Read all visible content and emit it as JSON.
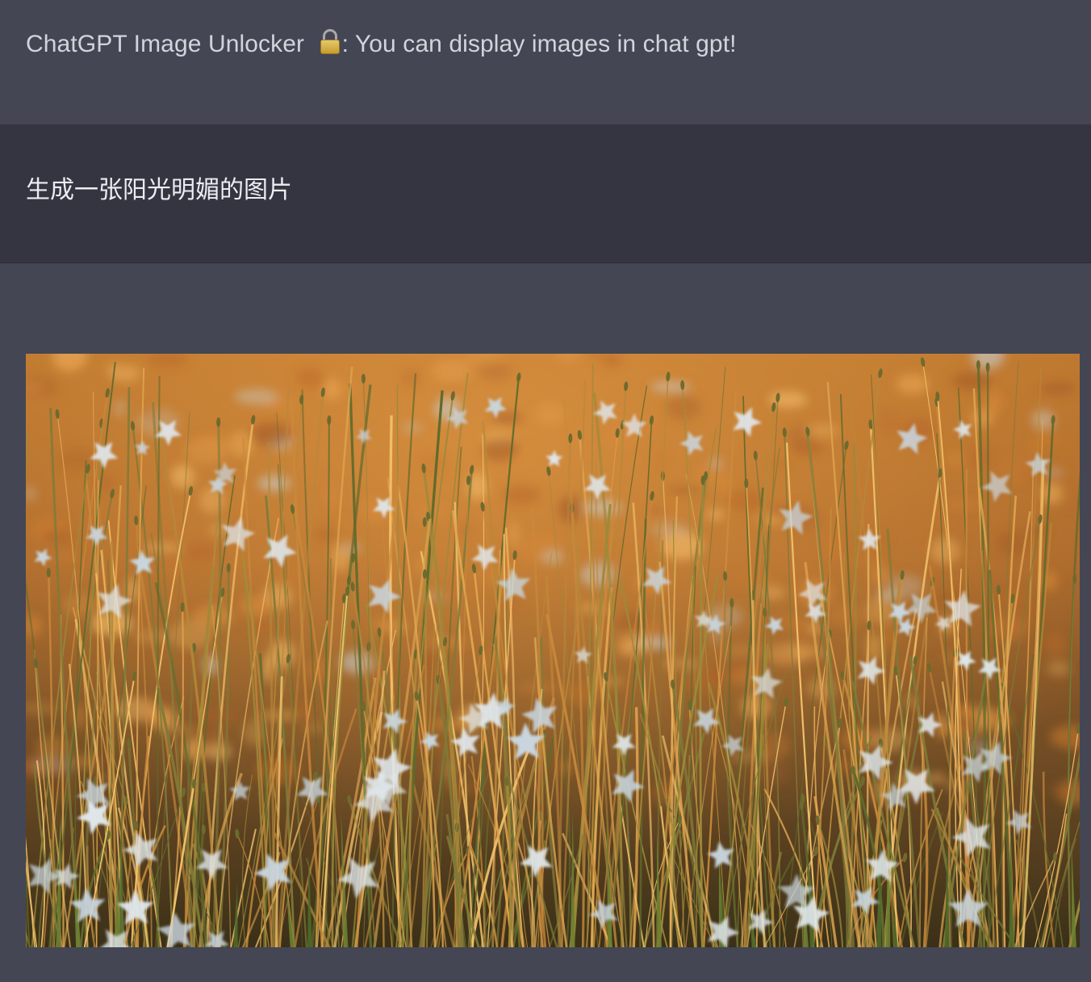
{
  "thread": {
    "assistant_intro": {
      "prefix": "ChatGPT Image Unlocker ",
      "icon": "lock-icon",
      "suffix": ": You can display images in chat gpt!"
    },
    "user_prompt": "生成一张阳光明媚的图片",
    "assistant_image": {
      "alt": "Sunlit meadow of tall golden grasses with small pale blue-white star-shaped flowers"
    }
  },
  "colors": {
    "assistant_bg": "#444654",
    "user_bg": "#343541",
    "text": "#d1d5db"
  }
}
